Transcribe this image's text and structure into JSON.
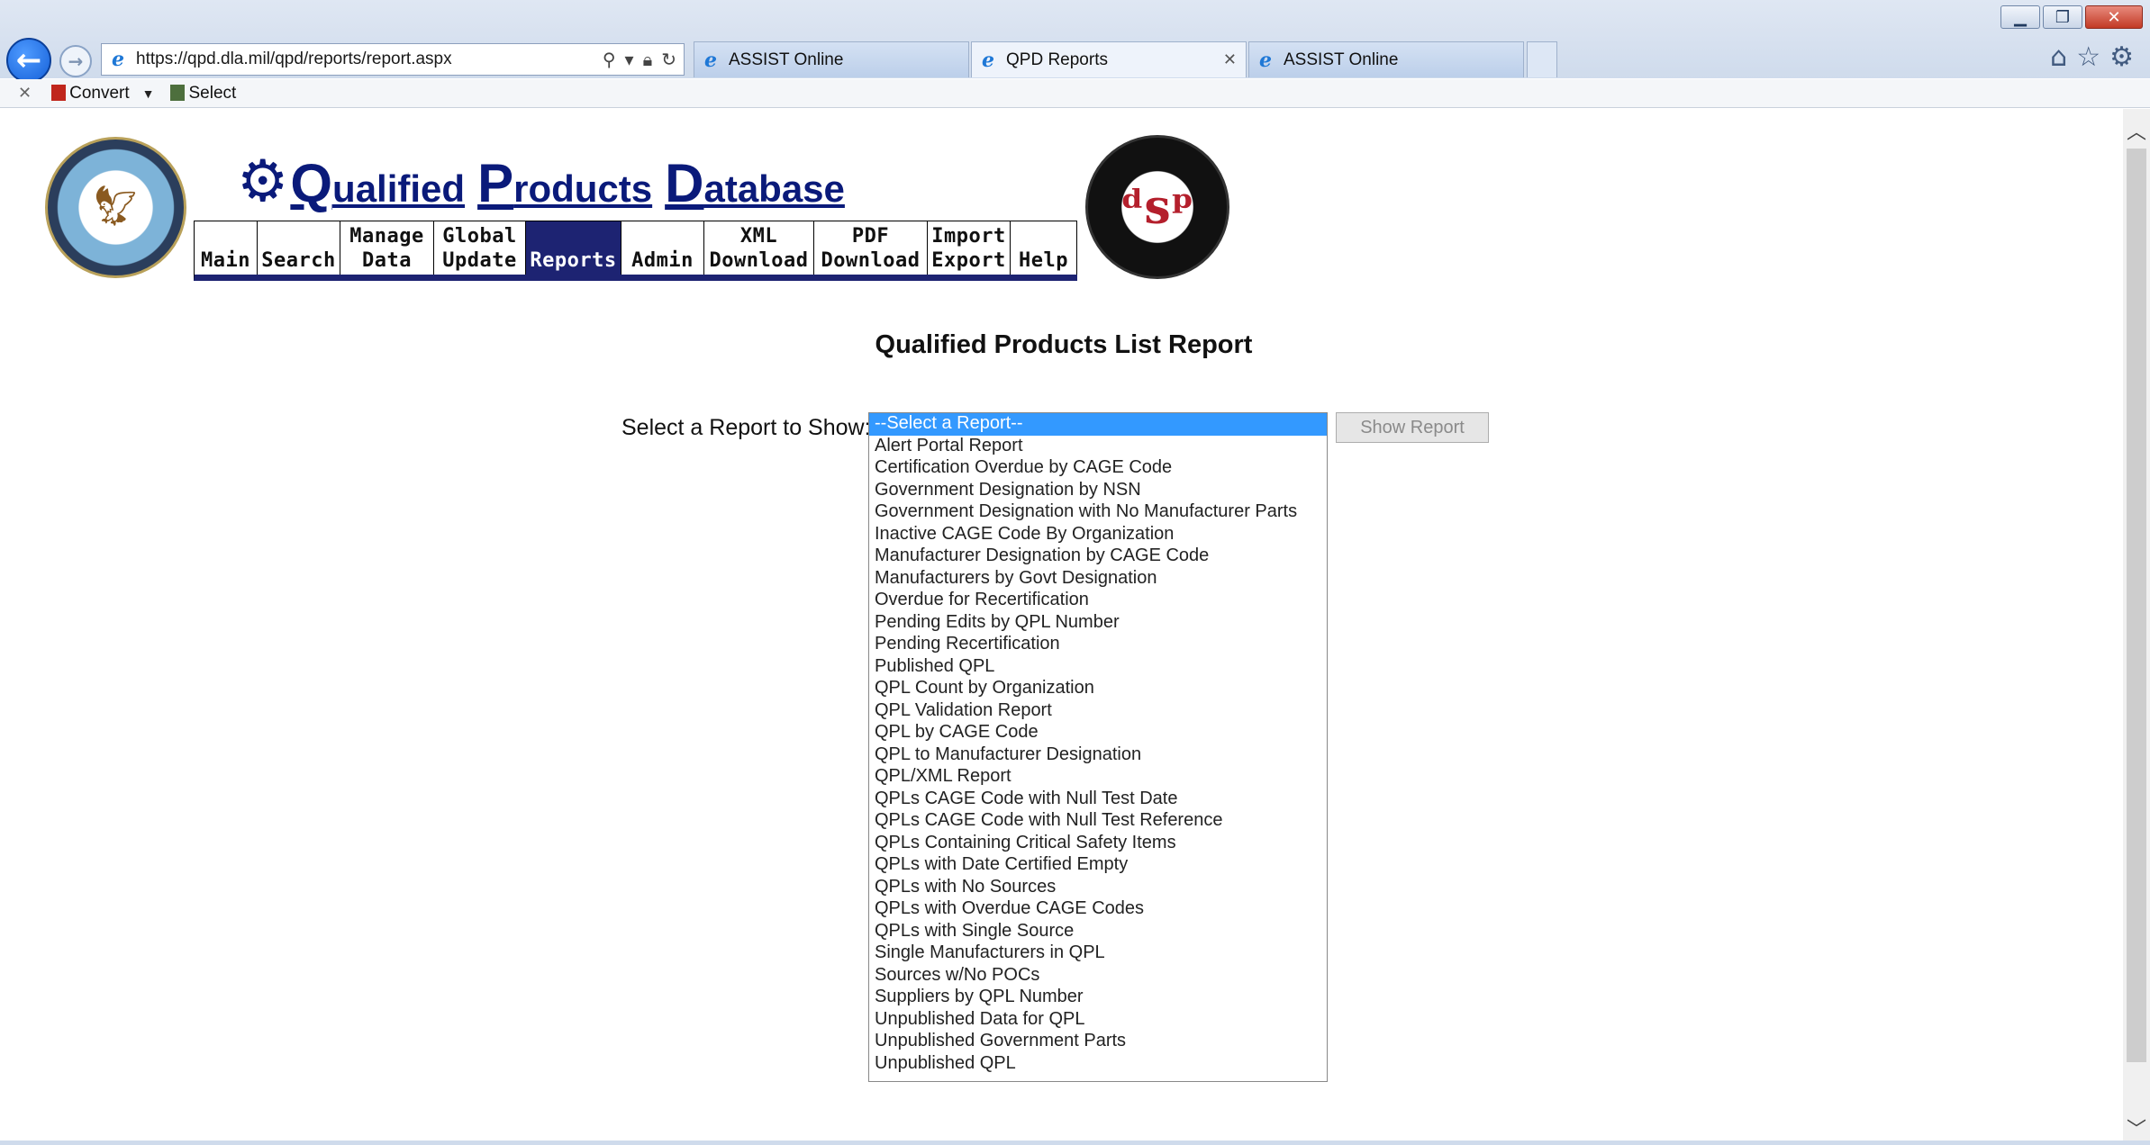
{
  "browser": {
    "url": "https://qpd.dla.mil/qpd/reports/report.aspx",
    "tabs": [
      {
        "label": "ASSIST Online",
        "active": false
      },
      {
        "label": "QPD Reports",
        "active": true
      },
      {
        "label": "ASSIST Online",
        "active": false
      }
    ],
    "command_bar": {
      "convert_label": "Convert",
      "select_label": "Select"
    }
  },
  "site": {
    "logo_text": {
      "q": "Q",
      "ualified": "ualified",
      "p": "P",
      "roducts": "roducts",
      "d": "D",
      "atabase": "atabase"
    },
    "nav": [
      {
        "label": "Main",
        "active": false
      },
      {
        "label": "Search",
        "active": false
      },
      {
        "label": "Manage\nData",
        "active": false
      },
      {
        "label": "Global\nUpdate",
        "active": false
      },
      {
        "label": "Reports",
        "active": true
      },
      {
        "label": "Admin",
        "active": false
      },
      {
        "label": "XML\nDownload",
        "active": false
      },
      {
        "label": "PDF\nDownload",
        "active": false
      },
      {
        "label": "Import\nExport",
        "active": false
      },
      {
        "label": "Help",
        "active": false
      }
    ]
  },
  "main": {
    "title": "Qualified Products List Report",
    "select_label": "Select a Report to Show:",
    "show_button": "Show Report",
    "reports": [
      "--Select a Report--",
      "Alert Portal Report",
      "Certification Overdue by CAGE Code",
      "Government Designation by NSN",
      "Government Designation with No Manufacturer Parts",
      "Inactive CAGE Code By Organization",
      "Manufacturer Designation by CAGE Code",
      "Manufacturers by Govt Designation",
      "Overdue for Recertification",
      "Pending Edits by QPL Number",
      "Pending Recertification",
      "Published QPL",
      "QPL Count by Organization",
      "QPL Validation Report",
      "QPL by CAGE Code",
      "QPL to Manufacturer Designation",
      "QPL/XML Report",
      "QPLs CAGE Code with Null Test Date",
      "QPLs CAGE Code with Null Test Reference",
      "QPLs Containing Critical Safety Items",
      "QPLs with Date Certified Empty",
      "QPLs with No Sources",
      "QPLs with Overdue CAGE Codes",
      "QPLs with Single Source",
      "Single Manufacturers in QPL",
      "Sources w/No POCs",
      "Suppliers by QPL Number",
      "Unpublished Data for QPL",
      "Unpublished Government Parts",
      "Unpublished QPL"
    ],
    "selected_index": 0
  },
  "colors": {
    "nav_active": "#1d2372",
    "selection": "#3399ff",
    "logo": "#0a1a7a"
  }
}
